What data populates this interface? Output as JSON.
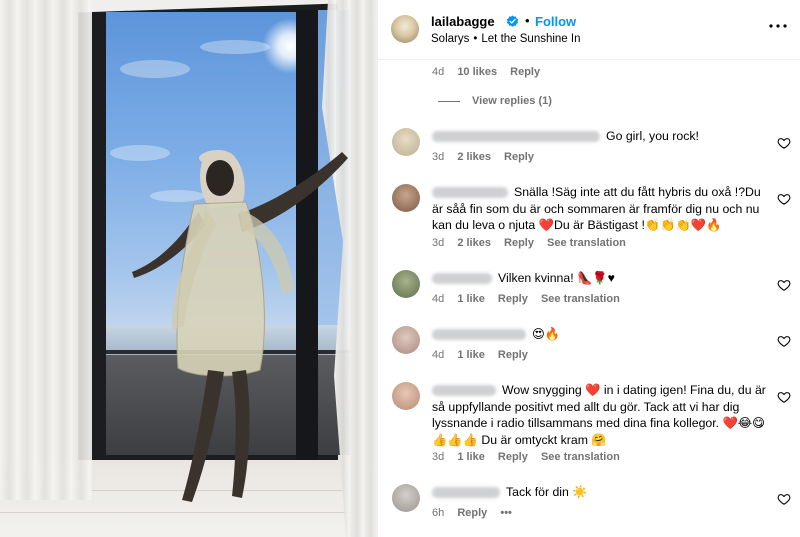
{
  "header": {
    "username": "lailabagge",
    "follow_label": "Follow",
    "audio_artist": "Solarys",
    "audio_sep": "•",
    "audio_title": "Let the Sunshine In"
  },
  "top_reply": {
    "time": "4d",
    "likes": "10 likes",
    "reply": "Reply",
    "view_replies": "View replies (1)"
  },
  "comments": [
    {
      "text": "Go girl, you rock!",
      "time": "3d",
      "likes": "2 likes",
      "reply": "Reply",
      "see_translation": ""
    },
    {
      "text": "Snälla !Säg inte att du fått hybris du oxå !?Du är såå fin som du är och sommaren är framför dig nu och nu kan du leva o njuta ❤️Du är Bästigast !👏👏👏❤️🔥",
      "time": "3d",
      "likes": "2 likes",
      "reply": "Reply",
      "see_translation": "See translation"
    },
    {
      "text": "Vilken kvinna! 👠🌹♥",
      "time": "4d",
      "likes": "1 like",
      "reply": "Reply",
      "see_translation": "See translation"
    },
    {
      "text": "😍🔥",
      "time": "4d",
      "likes": "1 like",
      "reply": "Reply",
      "see_translation": ""
    },
    {
      "text": "Wow snygging ❤️ in i dating igen! Fina du, du är så uppfyllande positivt med allt du gör. Tack att vi har dig lyssnande i radio tillsammans med dina fina kollegor. ❤️😂😋👍👍👍 Du är omtyckt kram 🤗",
      "time": "3d",
      "likes": "1 like",
      "reply": "Reply",
      "see_translation": "See translation"
    },
    {
      "text": "Tack för din ☀️",
      "time": "6h",
      "likes": "",
      "reply": "Reply",
      "see_translation": ""
    }
  ],
  "icons": {
    "verified": "verified-badge-icon",
    "more": "more-options-icon",
    "heart": "heart-outline-icon"
  },
  "colors": {
    "accent": "#0095f6",
    "secondary_text": "#737373",
    "divider": "#efefef"
  }
}
